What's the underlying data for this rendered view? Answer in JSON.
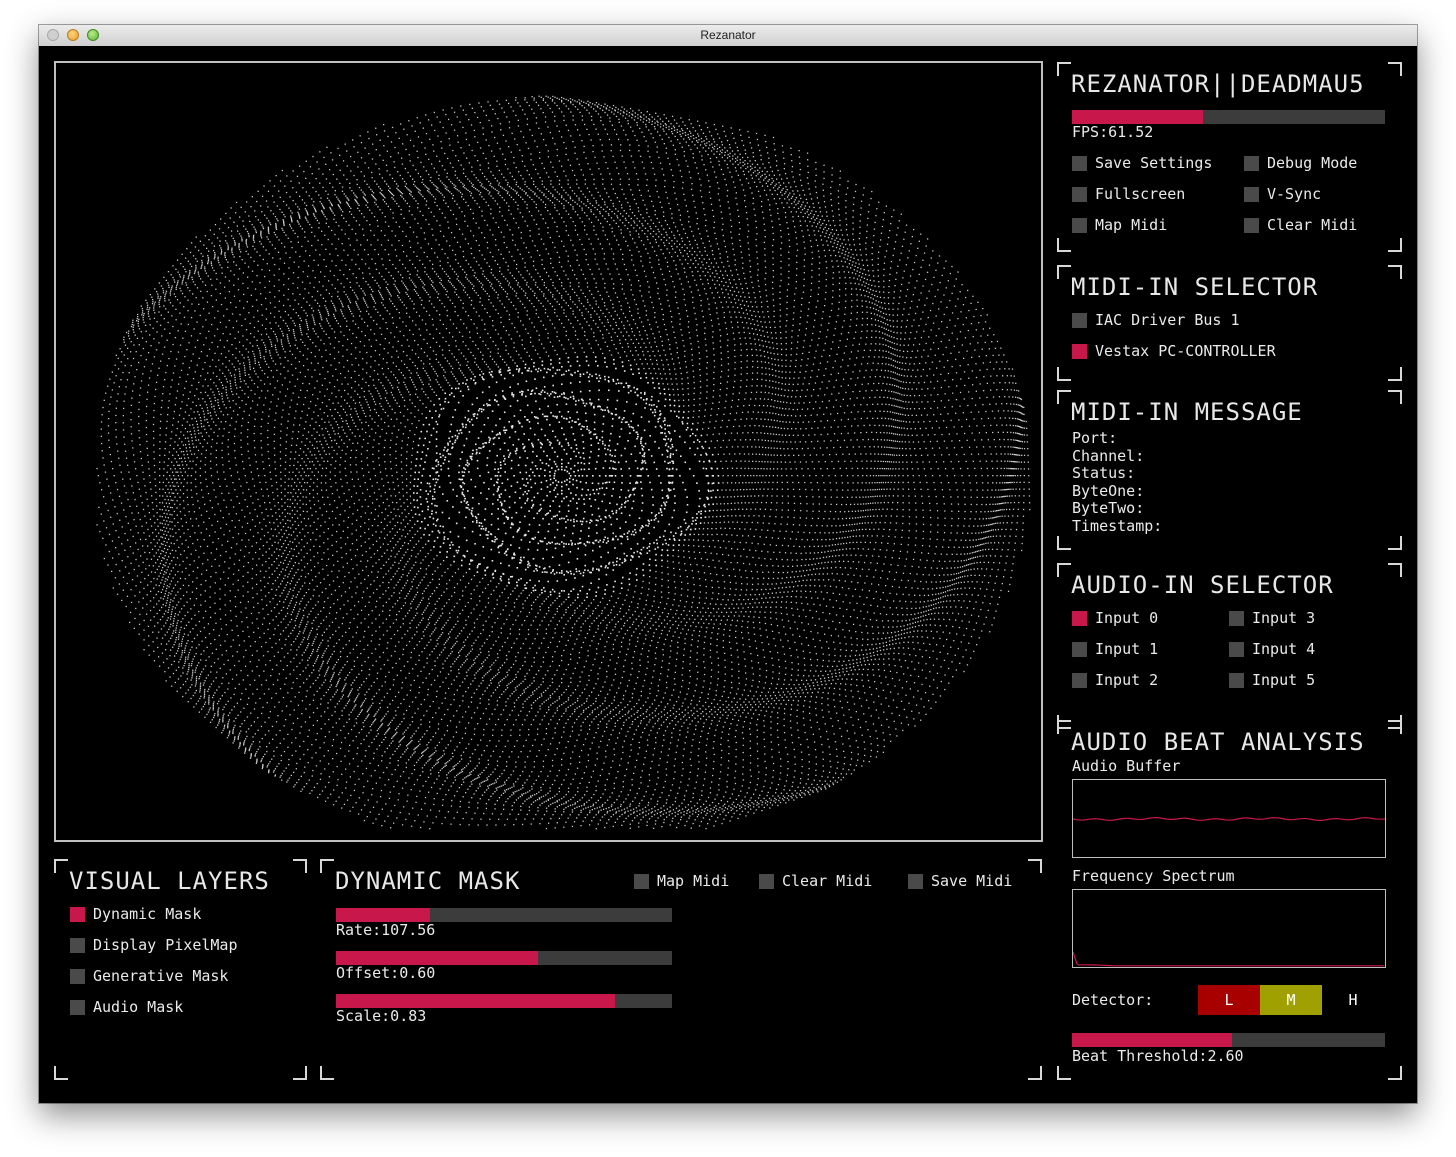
{
  "window": {
    "title": "Rezanator"
  },
  "header": {
    "title": "REZANATOR||DEADMAU5",
    "fps_label": "FPS:61.52",
    "fps_fraction": 0.42,
    "options": [
      {
        "label": "Save Settings",
        "on": false
      },
      {
        "label": "Debug Mode",
        "on": false
      },
      {
        "label": "Fullscreen",
        "on": false
      },
      {
        "label": "V-Sync",
        "on": false
      },
      {
        "label": "Map Midi",
        "on": false
      },
      {
        "label": "Clear Midi",
        "on": false
      }
    ]
  },
  "midi_selector": {
    "title": "MIDI-IN SELECTOR",
    "items": [
      {
        "label": "IAC Driver Bus 1",
        "on": false
      },
      {
        "label": "Vestax PC-CONTROLLER",
        "on": true
      }
    ]
  },
  "midi_message": {
    "title": "MIDI-IN MESSAGE",
    "fields": [
      "Port:",
      "Channel:",
      "Status:",
      "ByteOne:",
      "ByteTwo:",
      "Timestamp:"
    ]
  },
  "audio_selector": {
    "title": "AUDIO-IN SELECTOR",
    "inputs": [
      {
        "label": "Input 0",
        "on": true
      },
      {
        "label": "Input 3",
        "on": false
      },
      {
        "label": "Input 1",
        "on": false
      },
      {
        "label": "Input 4",
        "on": false
      },
      {
        "label": "Input 2",
        "on": false
      },
      {
        "label": "Input 5",
        "on": false
      }
    ]
  },
  "beat_analysis": {
    "title": "AUDIO BEAT ANALYSIS",
    "buffer_label": "Audio Buffer",
    "spectrum_label": "Frequency Spectrum",
    "detector_label": "Detector:",
    "detector": [
      {
        "label": "L",
        "color": "#a80000"
      },
      {
        "label": "M",
        "color": "#a0a000"
      },
      {
        "label": "H",
        "color": "#000000"
      }
    ],
    "threshold_label": "Beat Threshold:2.60",
    "threshold_fraction": 0.51,
    "line_color": "#c8174a"
  },
  "visual_layers": {
    "title": "VISUAL LAYERS",
    "items": [
      {
        "label": "Dynamic Mask",
        "on": true
      },
      {
        "label": "Display PixelMap",
        "on": false
      },
      {
        "label": "Generative Mask",
        "on": false
      },
      {
        "label": "Audio Mask",
        "on": false
      }
    ]
  },
  "dynamic_mask": {
    "title": "DYNAMIC MASK",
    "buttons": [
      {
        "label": "Map Midi",
        "on": false
      },
      {
        "label": "Clear Midi",
        "on": false
      },
      {
        "label": "Save Midi",
        "on": false
      }
    ],
    "sliders": [
      {
        "label": "Rate:107.56",
        "fraction": 0.28
      },
      {
        "label": "Offset:0.60",
        "fraction": 0.6
      },
      {
        "label": "Scale:0.83",
        "fraction": 0.83
      }
    ]
  },
  "colors": {
    "accent": "#c8174a",
    "off": "#4a4a4a",
    "track": "#3c3c3c"
  }
}
